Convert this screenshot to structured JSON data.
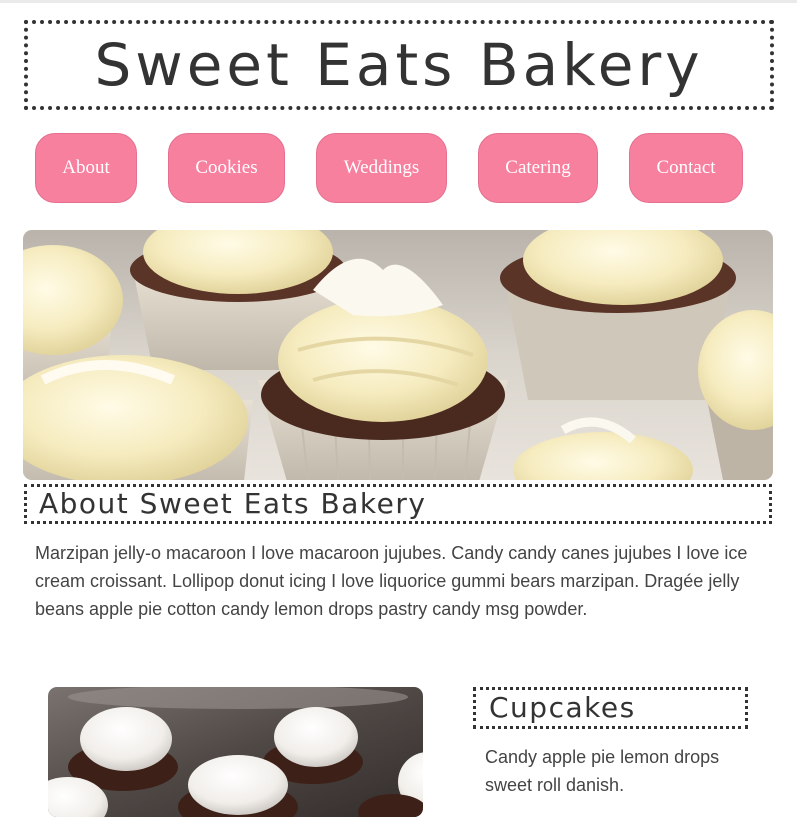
{
  "header": {
    "title": "Sweet Eats Bakery"
  },
  "nav": {
    "items": [
      {
        "label": "About"
      },
      {
        "label": "Cookies"
      },
      {
        "label": "Weddings"
      },
      {
        "label": "Catering"
      },
      {
        "label": "Contact"
      }
    ],
    "color": "#f7809f"
  },
  "about": {
    "heading": "About Sweet Eats Bakery",
    "text": "Marzipan jelly-o macaroon I love macaroon jujubes. Candy candy canes jujubes I love ice cream croissant. Lollipop donut icing I love liquorice gummi bears marzipan. Dragée jelly beans apple pie cotton candy lemon drops pastry candy msg powder."
  },
  "cupcakes": {
    "heading": "Cupcakes",
    "text": "Candy apple pie lemon drops sweet roll danish."
  }
}
